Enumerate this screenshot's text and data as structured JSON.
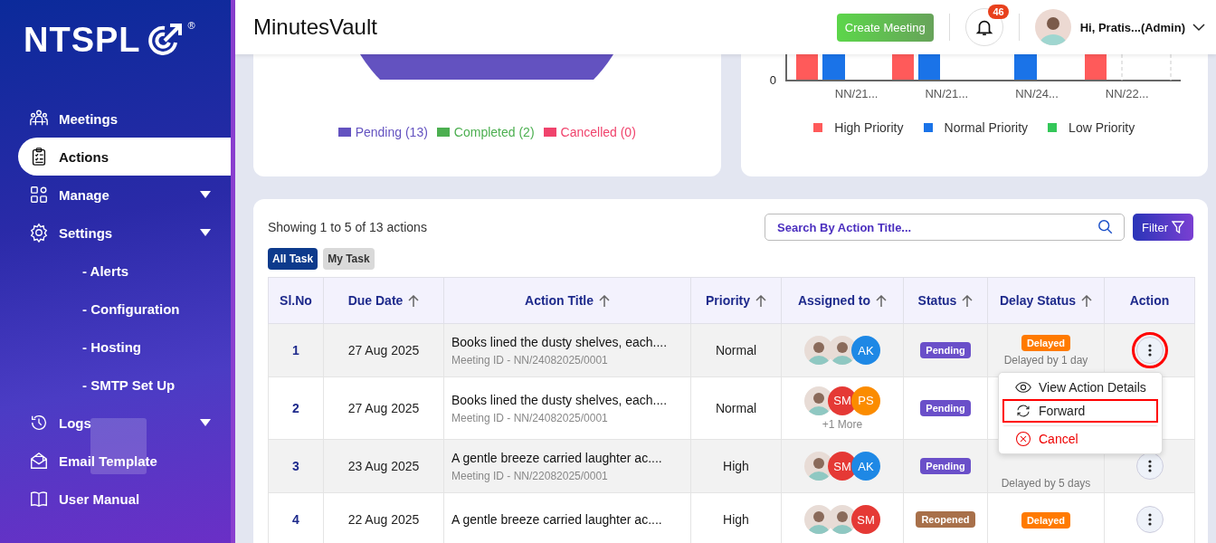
{
  "sidebar": {
    "logo": {
      "text": "NTSPL",
      "mark": "®"
    },
    "items": [
      {
        "label": "Meetings",
        "selected": false
      },
      {
        "label": "Actions",
        "selected": true
      },
      {
        "label": "Manage",
        "selected": false,
        "caret": true
      },
      {
        "label": "Settings",
        "selected": false,
        "caret": true,
        "children": [
          {
            "label": "- Alerts"
          },
          {
            "label": "- Configuration"
          },
          {
            "label": "- Hosting"
          },
          {
            "label": "- SMTP Set Up"
          }
        ]
      },
      {
        "label": "Logs",
        "selected": false,
        "caret": true
      },
      {
        "label": "Email Template",
        "selected": false
      },
      {
        "label": "User Manual",
        "selected": false
      }
    ]
  },
  "header": {
    "title": "MinutesVault",
    "create_button": "Create Meeting",
    "notifications": "46",
    "user": "Hi, Pratis...(Admin)"
  },
  "status_chart": {
    "legend": [
      {
        "label": "Pending (13)",
        "color": "#6352c0"
      },
      {
        "label": "Completed (2)",
        "color": "#4caf50"
      },
      {
        "label": "Cancelled (0)",
        "color": "#f0436c"
      }
    ]
  },
  "priority_chart": {
    "y_tick": "0",
    "categories": [
      "NN/21...",
      "NN/21...",
      "NN/24...",
      "NN/22..."
    ],
    "legend": [
      {
        "label": "High Priority",
        "color": "#ff5a5a"
      },
      {
        "label": "Normal Priority",
        "color": "#1a73e8"
      },
      {
        "label": "Low Priority",
        "color": "#34c759"
      }
    ]
  },
  "table_panel": {
    "summary": "Showing 1 to 5 of 13 actions",
    "search": {
      "placeholder": "Search By Action Title..."
    },
    "filter_button": "Filter",
    "tabs": [
      {
        "label": "All Task",
        "selected": true
      },
      {
        "label": "My Task",
        "selected": false
      }
    ],
    "columns": [
      {
        "label": "Sl.No",
        "sortable": false
      },
      {
        "label": "Due Date",
        "sortable": true
      },
      {
        "label": "Action Title",
        "sortable": true
      },
      {
        "label": "Priority",
        "sortable": true
      },
      {
        "label": "Assigned to",
        "sortable": true
      },
      {
        "label": "Status",
        "sortable": true
      },
      {
        "label": "Delay Status",
        "sortable": true
      },
      {
        "label": "Action",
        "sortable": false
      }
    ],
    "rows": [
      {
        "no": "1",
        "due": "27 Aug 2025",
        "title": "Books lined the dusty shelves, each....",
        "meeting_id": "Meeting ID - NN/24082025/0001",
        "priority": "Normal",
        "assignees": [
          {
            "kind": "photo"
          },
          {
            "kind": "photo"
          },
          {
            "kind": "initials",
            "initials": "AK",
            "color": "#1e88e5"
          }
        ],
        "status": {
          "label": "Pending",
          "color": "#6a4fc9"
        },
        "delay": {
          "badge": "Delayed",
          "text": "Delayed by 1 day"
        },
        "action_button": {
          "highlighted": true
        },
        "menu": {
          "items": [
            {
              "label": "View Action Details",
              "kind": "view",
              "highlighted": false
            },
            {
              "label": "Forward",
              "kind": "forward",
              "highlighted": true
            },
            {
              "label": "Cancel",
              "kind": "cancel",
              "highlighted": false
            }
          ]
        }
      },
      {
        "no": "2",
        "due": "27 Aug 2025",
        "title": "Books lined the dusty shelves, each....",
        "meeting_id": "Meeting ID - NN/24082025/0001",
        "priority": "Normal",
        "assignees": [
          {
            "kind": "photo"
          },
          {
            "kind": "initials",
            "initials": "SM",
            "color": "#e53935"
          },
          {
            "kind": "initials",
            "initials": "PS",
            "color": "#fb8c00"
          }
        ],
        "more": "+1 More",
        "status": {
          "label": "Pending",
          "color": "#6a4fc9"
        }
      },
      {
        "no": "3",
        "due": "23 Aug 2025",
        "title": "A gentle breeze carried laughter ac....",
        "meeting_id": "Meeting ID - NN/22082025/0001",
        "priority": "High",
        "assignees": [
          {
            "kind": "photo"
          },
          {
            "kind": "initials",
            "initials": "SM",
            "color": "#e53935"
          },
          {
            "kind": "initials",
            "initials": "AK",
            "color": "#1e88e5"
          }
        ],
        "status": {
          "label": "Pending",
          "color": "#6a4fc9"
        },
        "delay": {
          "text": "Delayed by 5 days"
        },
        "action_button": {
          "highlighted": false
        }
      },
      {
        "no": "4",
        "due": "22 Aug 2025",
        "title": "A gentle breeze carried laughter ac....",
        "priority": "High",
        "assignees": [
          {
            "kind": "photo"
          },
          {
            "kind": "photo"
          },
          {
            "kind": "initials",
            "initials": "SM",
            "color": "#e53935"
          }
        ],
        "status": {
          "label": "Reopened",
          "color": "#a8704a"
        },
        "delay": {
          "badge": "Delayed"
        },
        "action_button": {
          "highlighted": false
        }
      }
    ]
  }
}
